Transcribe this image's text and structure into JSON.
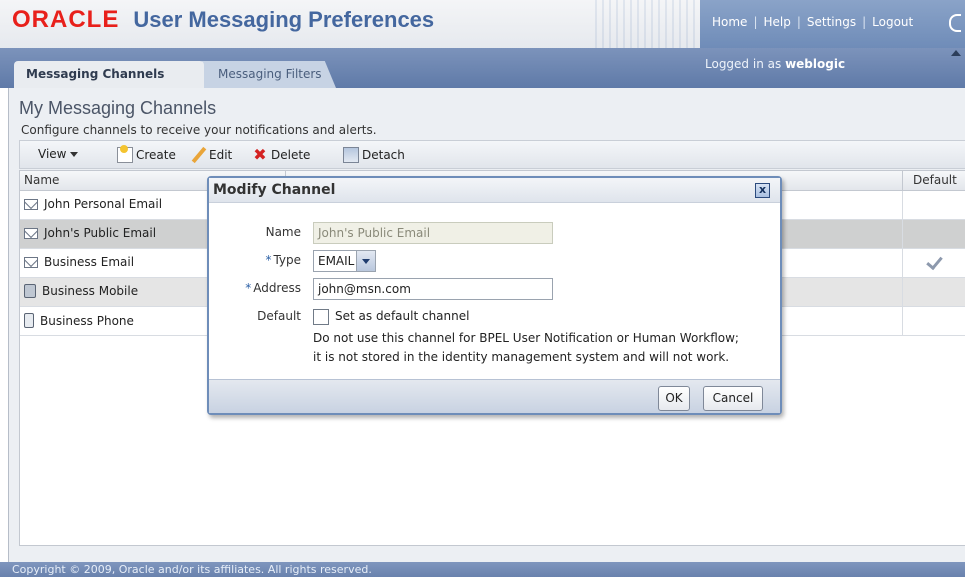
{
  "header": {
    "logo": "ORACLE",
    "title": "User Messaging Preferences",
    "links": [
      "Home",
      "Help",
      "Settings",
      "Logout"
    ]
  },
  "tabs": [
    {
      "label": "Messaging Channels",
      "active": true
    },
    {
      "label": "Messaging Filters",
      "active": false
    }
  ],
  "session": {
    "prefix": "Logged in as",
    "user": "weblogic"
  },
  "page": {
    "title": "My Messaging Channels",
    "description": "Configure channels to receive your notifications and alerts."
  },
  "toolbar": {
    "view": "View",
    "create": "Create",
    "edit": "Edit",
    "delete": "Delete",
    "detach": "Detach"
  },
  "table": {
    "columns": [
      "Name",
      "Default"
    ],
    "rows": [
      {
        "name": "John Personal Email",
        "icon": "envelope-icon",
        "default": false
      },
      {
        "name": "John's Public Email",
        "icon": "envelope-icon",
        "default": false,
        "selected": true
      },
      {
        "name": "Business Email",
        "icon": "envelope-icon",
        "default": true
      },
      {
        "name": "Business Mobile",
        "icon": "mobile-icon",
        "default": false
      },
      {
        "name": "Business Phone",
        "icon": "phone-icon",
        "default": false
      }
    ]
  },
  "dialog": {
    "title": "Modify Channel",
    "close": "x",
    "name_label": "Name",
    "name_value": "John's Public Email",
    "type_label": "Type",
    "type_value": "EMAIL",
    "address_label": "Address",
    "address_value": "john@msn.com",
    "default_label": "Default",
    "checkbox_label": "Set as default channel",
    "note_line1": "Do not use this channel for BPEL User Notification or Human Workflow;",
    "note_line2": "it is not stored in the identity management system and will not work.",
    "ok": "OK",
    "cancel": "Cancel",
    "required_mark": "*"
  },
  "footer": {
    "copyright": "Copyright © 2009, Oracle and/or its affiliates. All rights reserved."
  }
}
